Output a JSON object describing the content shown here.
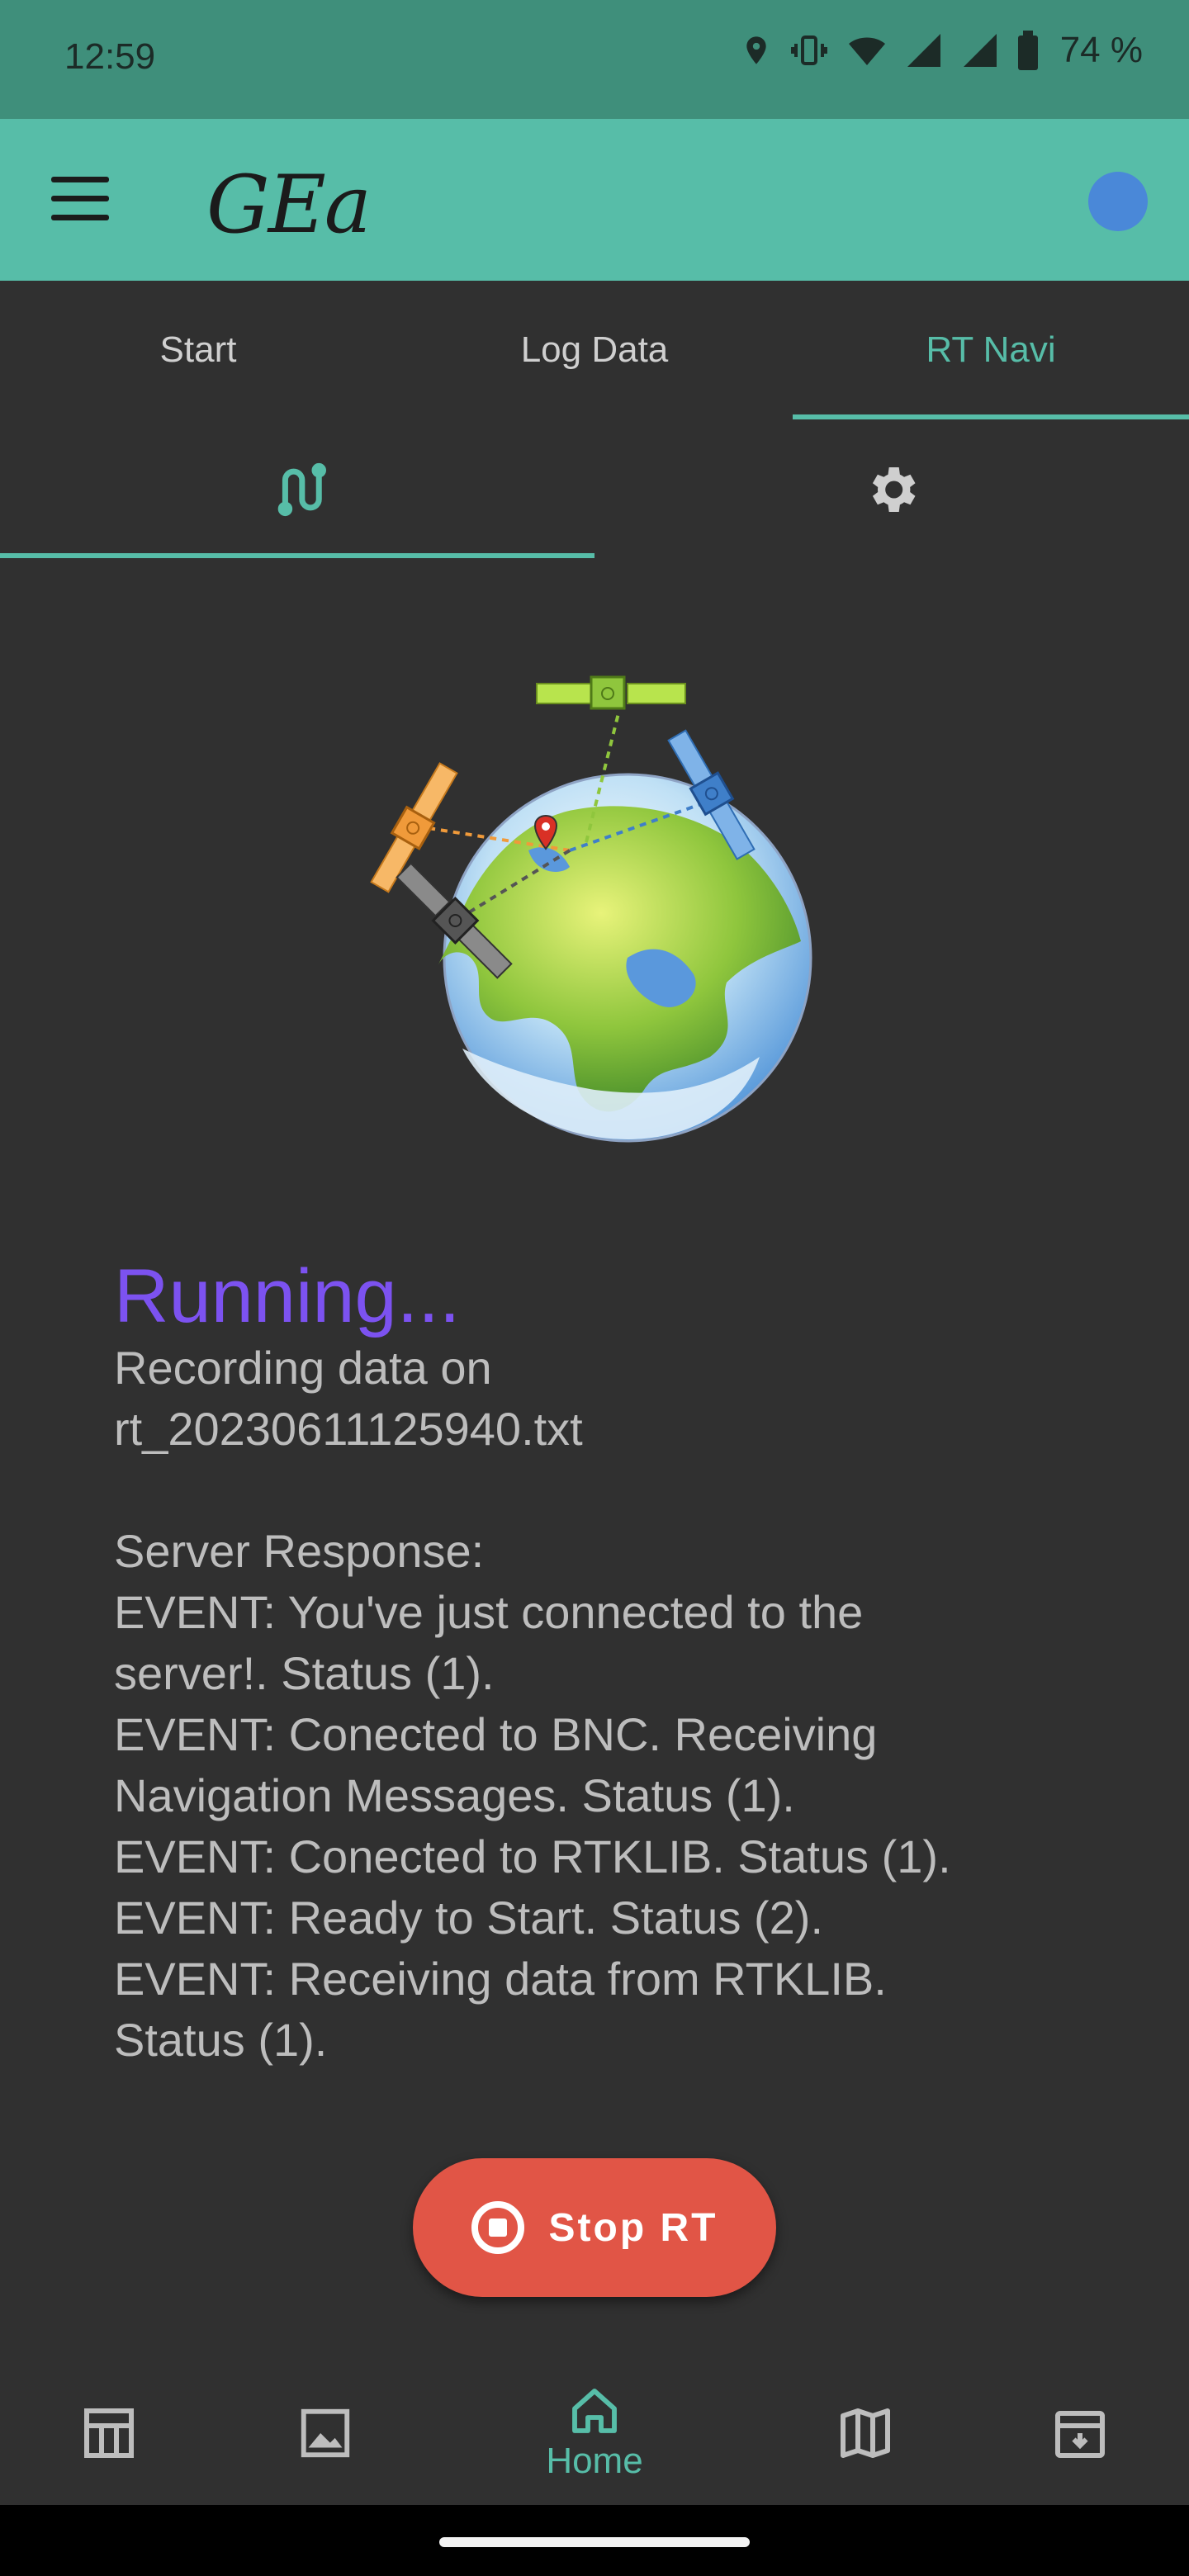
{
  "status_bar": {
    "time": "12:59",
    "battery": "74 %"
  },
  "app_bar": {
    "logo": "GEa",
    "menu_icon": "hamburger-icon",
    "avatar_color": "#4a88d8"
  },
  "tabs": [
    {
      "label": "Start",
      "active": false
    },
    {
      "label": "Log Data",
      "active": false
    },
    {
      "label": "RT Navi",
      "active": true
    }
  ],
  "subtabs": [
    {
      "icon": "route-icon",
      "active": true
    },
    {
      "icon": "gear-icon",
      "active": false
    }
  ],
  "main": {
    "status_title": "Running...",
    "recording_line1": "Recording data on",
    "recording_file": "rt_20230611125940.txt",
    "server_header": "Server Response:",
    "events": [
      "EVENT: You've just connected to the",
      "server!. Status (1).",
      "EVENT: Conected to BNC. Receiving",
      "Navigation Messages. Status (1).",
      "EVENT: Conected to RTKLIB. Status (1).",
      "EVENT: Ready to Start. Status (2).",
      "EVENT: Receiving data from RTKLIB.",
      "Status (1)."
    ]
  },
  "stop_button": {
    "label": "Stop RT"
  },
  "bottom_nav": [
    {
      "icon": "table-icon",
      "label": ""
    },
    {
      "icon": "image-icon",
      "label": ""
    },
    {
      "icon": "home-icon",
      "label": "Home",
      "active": true
    },
    {
      "icon": "map-icon",
      "label": ""
    },
    {
      "icon": "archive-icon",
      "label": ""
    }
  ],
  "colors": {
    "accent": "#57bda8",
    "running": "#7c52f0",
    "stop": "#e15546"
  }
}
